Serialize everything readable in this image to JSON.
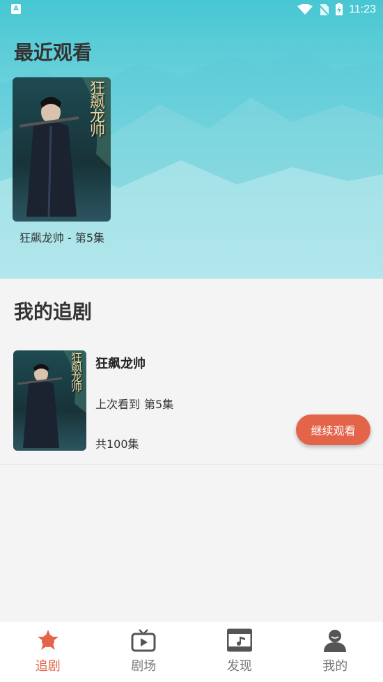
{
  "status_bar": {
    "time": "11:23",
    "left_icon_letter": "A"
  },
  "recent": {
    "title": "最近观看",
    "items": [
      {
        "poster_text": "狂飙龙帅",
        "caption": "狂飙龙帅 - 第5集"
      }
    ]
  },
  "favorites": {
    "title": "我的追剧",
    "items": [
      {
        "poster_text": "狂飙龙帅",
        "title": "狂飙龙帅",
        "last_watched_label": "上次看到",
        "last_watched_episode": "第5集",
        "total": "共100集",
        "continue_label": "继续观看"
      }
    ]
  },
  "tabbar": {
    "tabs": [
      {
        "label": "追剧",
        "icon": "star-icon",
        "active": true
      },
      {
        "label": "剧场",
        "icon": "tv-icon",
        "active": false
      },
      {
        "label": "发现",
        "icon": "music-film-icon",
        "active": false
      },
      {
        "label": "我的",
        "icon": "user-icon",
        "active": false
      }
    ]
  },
  "colors": {
    "accent": "#e4644a",
    "hero_top": "#47c7d3",
    "inactive_tab": "#777777",
    "background": "#f4f4f4"
  }
}
